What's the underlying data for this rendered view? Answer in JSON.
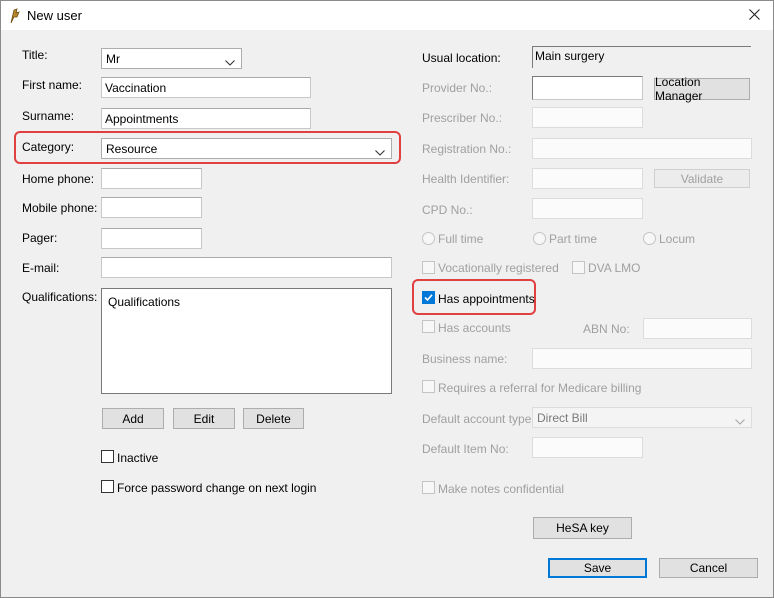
{
  "window": {
    "title": "New user"
  },
  "left": {
    "title_label": "Title:",
    "title_value": "Mr",
    "first_name_label": "First name:",
    "first_name_value": "Vaccination",
    "surname_label": "Surname:",
    "surname_value": "Appointments",
    "category_label": "Category:",
    "category_value": "Resource",
    "home_phone_label": "Home phone:",
    "home_phone_value": "",
    "mobile_phone_label": "Mobile phone:",
    "mobile_phone_value": "",
    "pager_label": "Pager:",
    "pager_value": "",
    "email_label": "E-mail:",
    "email_value": "",
    "qualifications_label": "Qualifications:",
    "qualifications_value": "Qualifications",
    "add_label": "Add",
    "edit_label": "Edit",
    "delete_label": "Delete",
    "inactive_label": "Inactive",
    "force_password_label": "Force password change on next login"
  },
  "right": {
    "usual_location_label": "Usual location:",
    "usual_location_value": "Main surgery",
    "provider_no_label": "Provider No.:",
    "location_manager_label": "Location Manager",
    "prescriber_no_label": "Prescriber No.:",
    "registration_no_label": "Registration No.:",
    "health_identifier_label": "Health Identifier:",
    "validate_label": "Validate",
    "cpd_no_label": "CPD No.:",
    "full_time_label": "Full time",
    "part_time_label": "Part time",
    "locum_label": "Locum",
    "vocationally_registered_label": "Vocationally registered",
    "dva_lmo_label": "DVA LMO",
    "has_appointments_label": "Has appointments",
    "has_accounts_label": "Has accounts",
    "abn_no_label": "ABN No:",
    "business_name_label": "Business name:",
    "referral_label": "Requires a referral for Medicare billing",
    "default_account_type_label": "Default account type:",
    "default_account_type_value": "Direct Bill",
    "default_item_no_label": "Default Item No:",
    "make_notes_confidential_label": "Make notes confidential",
    "hesa_key_label": "HeSA key"
  },
  "footer": {
    "save_label": "Save",
    "cancel_label": "Cancel"
  },
  "state": {
    "has_appointments": true,
    "inactive": false,
    "force_password_change": false
  },
  "colors": {
    "accent": "#0078d7",
    "highlight": "#e04040"
  }
}
